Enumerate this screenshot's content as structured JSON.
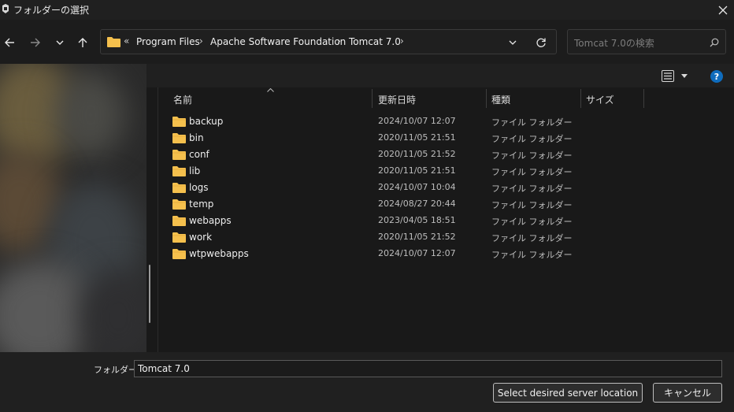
{
  "window": {
    "title": "フォルダーの選択"
  },
  "breadcrumb": {
    "overflow": "«",
    "items": [
      "Program Files",
      "Apache Software Foundation",
      "Tomcat 7.0"
    ]
  },
  "search": {
    "placeholder": "Tomcat 7.0の検索"
  },
  "columns": {
    "name": "名前",
    "modified": "更新日時",
    "type": "種類",
    "size": "サイズ"
  },
  "rows": [
    {
      "name": "backup",
      "modified": "2024/10/07 12:07",
      "type": "ファイル フォルダー"
    },
    {
      "name": "bin",
      "modified": "2020/11/05 21:51",
      "type": "ファイル フォルダー"
    },
    {
      "name": "conf",
      "modified": "2020/11/05 21:52",
      "type": "ファイル フォルダー"
    },
    {
      "name": "lib",
      "modified": "2020/11/05 21:51",
      "type": "ファイル フォルダー"
    },
    {
      "name": "logs",
      "modified": "2024/10/07 10:04",
      "type": "ファイル フォルダー"
    },
    {
      "name": "temp",
      "modified": "2024/08/27 20:44",
      "type": "ファイル フォルダー"
    },
    {
      "name": "webapps",
      "modified": "2023/04/05 18:51",
      "type": "ファイル フォルダー"
    },
    {
      "name": "work",
      "modified": "2020/11/05 21:52",
      "type": "ファイル フォルダー"
    },
    {
      "name": "wtpwebapps",
      "modified": "2024/10/07 12:07",
      "type": "ファイル フォルダー"
    }
  ],
  "footer": {
    "folder_label": "フォルダー:",
    "folder_value": "Tomcat 7.0",
    "select_label": "Select desired server location",
    "cancel_label": "キャンセル"
  },
  "icons": {
    "back": "arrow-left-icon",
    "forward": "arrow-right-icon",
    "recent": "chevron-down-icon",
    "up": "arrow-up-icon",
    "folder": "folder-icon",
    "dropdown": "chevron-down-icon",
    "refresh": "refresh-icon",
    "search": "search-icon",
    "view": "view-options-icon",
    "help": "help-icon",
    "close": "close-icon"
  },
  "colors": {
    "folder": "#f5c04d",
    "help": "#0f6cbd",
    "background": "#191919"
  }
}
